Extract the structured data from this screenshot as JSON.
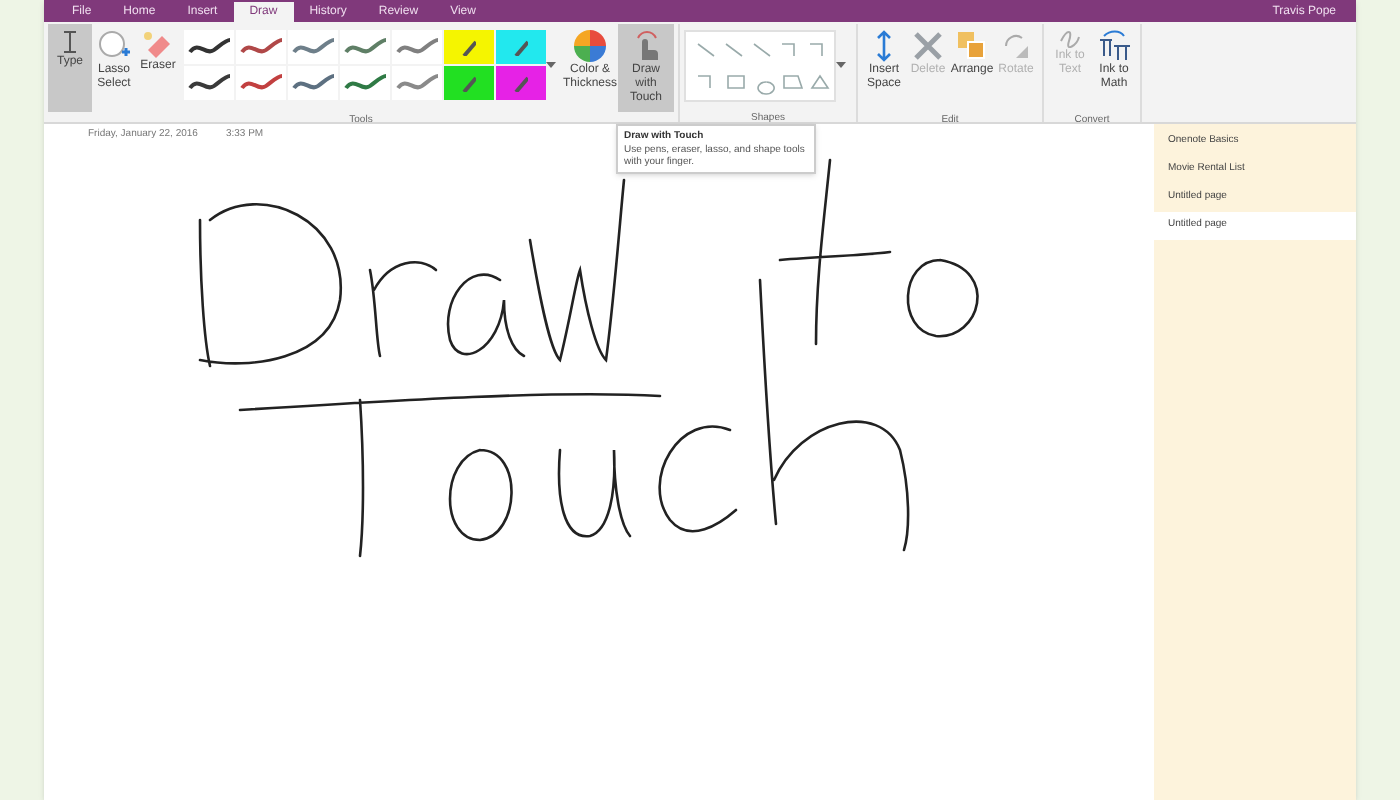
{
  "tabs": [
    {
      "label": "File",
      "selected": false
    },
    {
      "label": "Home",
      "selected": false
    },
    {
      "label": "Insert",
      "selected": false
    },
    {
      "label": "Draw",
      "selected": true
    },
    {
      "label": "History",
      "selected": false
    },
    {
      "label": "Review",
      "selected": false
    },
    {
      "label": "View",
      "selected": false
    }
  ],
  "user": "Travis Pope",
  "tools": [
    {
      "label": "Type",
      "kind": "type",
      "selected": true
    },
    {
      "label": "Lasso Select",
      "kind": "lasso",
      "selected": false
    },
    {
      "label": "Eraser",
      "kind": "eraser",
      "selected": false
    }
  ],
  "pens": [
    {
      "kind": "pen",
      "color": "#333333"
    },
    {
      "kind": "pen",
      "color": "#b04848"
    },
    {
      "kind": "pen",
      "color": "#6e7f8a"
    },
    {
      "kind": "pen",
      "color": "#5f7f66"
    },
    {
      "kind": "pen",
      "color": "#808080"
    },
    {
      "kind": "highlighter",
      "color": "#f5f500"
    },
    {
      "kind": "highlighter",
      "color": "#22e8ee"
    },
    {
      "kind": "pen",
      "color": "#3a3a3a"
    },
    {
      "kind": "pen",
      "color": "#c24040"
    },
    {
      "kind": "pen",
      "color": "#5d7081"
    },
    {
      "kind": "pen",
      "color": "#2f7a45"
    },
    {
      "kind": "pen",
      "color": "#8a8a8a"
    },
    {
      "kind": "highlighter",
      "color": "#22e022"
    },
    {
      "kind": "highlighter",
      "color": "#e622e6"
    }
  ],
  "color_thickness": {
    "label": "Color & Thickness"
  },
  "draw_with_touch": {
    "label": "Draw with Touch",
    "selected": true
  },
  "tools_group": "Tools",
  "shapes_group": "Shapes",
  "edit": [
    {
      "label": "Insert Space",
      "kind": "insert",
      "disabled": false
    },
    {
      "label": "Delete",
      "kind": "delete",
      "disabled": true
    },
    {
      "label": "Arrange",
      "kind": "arrange",
      "disabled": false
    },
    {
      "label": "Rotate",
      "kind": "rotate",
      "disabled": true
    }
  ],
  "edit_group": "Edit",
  "convert": [
    {
      "label": "Ink to Text",
      "kind": "text",
      "disabled": true
    },
    {
      "label": "Ink to Math",
      "kind": "math",
      "disabled": false
    }
  ],
  "convert_group": "Convert",
  "page_date": "Friday, January 22, 2016",
  "page_time": "3:33 PM",
  "tooltip": {
    "title": "Draw with Touch",
    "body": "Use pens, eraser, lasso, and shape tools with your finger."
  },
  "pages": [
    {
      "label": "Onenote Basics",
      "selected": false
    },
    {
      "label": "Movie Rental List",
      "selected": false
    },
    {
      "label": "Untitled page",
      "selected": false
    },
    {
      "label": "Untitled page",
      "selected": true
    }
  ]
}
